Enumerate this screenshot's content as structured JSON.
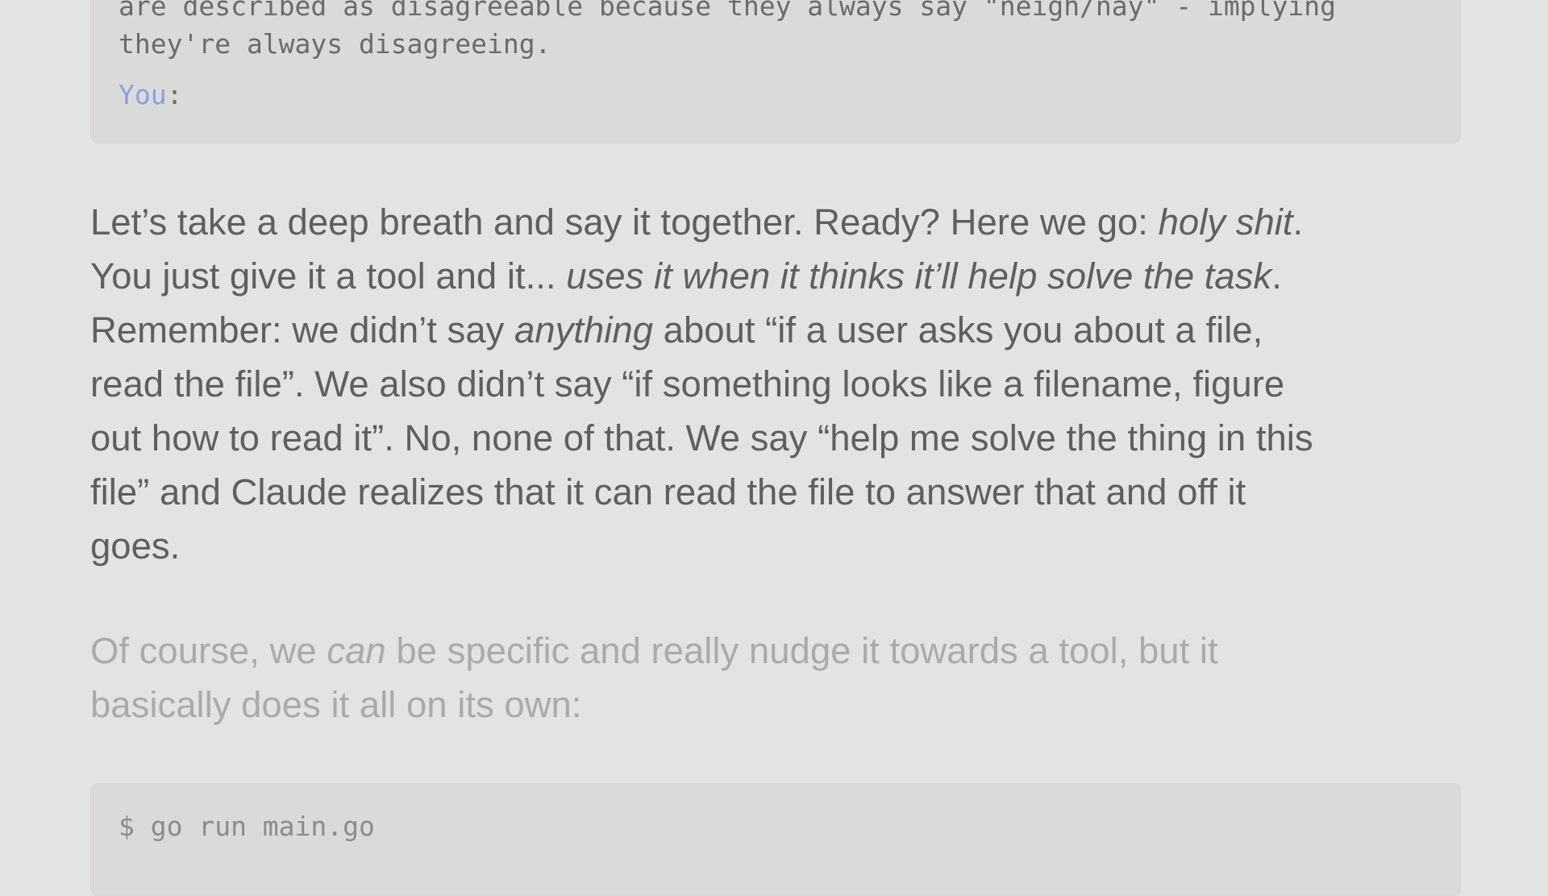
{
  "code_block_top": {
    "line_1": "are described as disagreeable because they always say \"neigh/nay\" - implying",
    "line_2": "they're always disagreeing.",
    "prompt_label": "You",
    "prompt_colon": ":"
  },
  "paragraph_main": {
    "line_1_a": "Let’s take a deep breath and say it together. Ready? Here we go: ",
    "line_1_em": "holy shit",
    "line_1_b": ".",
    "line_2_a": "You just give it a tool and it... ",
    "line_2_em": "uses it when it thinks it’ll help solve the task",
    "line_2_b": ".",
    "line_3_a": "Remember: we didn’t say ",
    "line_3_em": "anything",
    "line_3_b": " about “if a user asks you about a file,",
    "line_4": "read the file”. We also didn’t say “if something looks like a filename, figure",
    "line_5": "out how to read it”. No, none of that. We say “help me solve the thing in this",
    "line_6": "file” and Claude realizes that it can read the file to answer that and off it",
    "line_7": "goes."
  },
  "paragraph_faded": {
    "line_1_a": "Of course, we ",
    "line_1_em": "can",
    "line_1_b": " be specific and really nudge it towards a tool, but it",
    "line_2": "basically does it all on its own:"
  },
  "code_block_bottom": {
    "line_1": "$ go run main.go"
  },
  "colors": {
    "background": "#e2e4e1",
    "code_background": "#dadbd8",
    "prompt_label": "#86a0e8",
    "body_text": "#5e605e",
    "faded_text": "#a9aba9"
  }
}
